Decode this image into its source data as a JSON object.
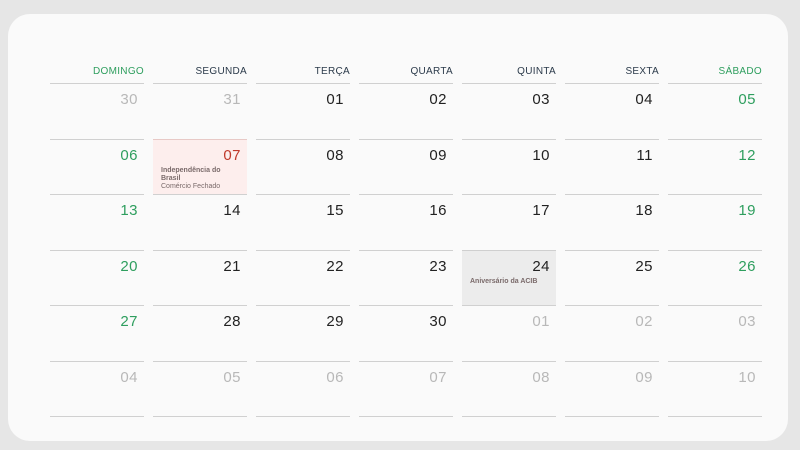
{
  "weekdays": [
    {
      "label": "DOMINGO",
      "weekend": true
    },
    {
      "label": "SEGUNDA",
      "weekend": false
    },
    {
      "label": "TERÇA",
      "weekend": false
    },
    {
      "label": "QUARTA",
      "weekend": false
    },
    {
      "label": "QUINTA",
      "weekend": false
    },
    {
      "label": "SEXTA",
      "weekend": false
    },
    {
      "label": "SÁBADO",
      "weekend": true
    }
  ],
  "weeks": [
    [
      {
        "day": "30",
        "muted": true
      },
      {
        "day": "31",
        "muted": true
      },
      {
        "day": "01"
      },
      {
        "day": "02"
      },
      {
        "day": "03"
      },
      {
        "day": "04"
      },
      {
        "day": "05"
      }
    ],
    [
      {
        "day": "06"
      },
      {
        "day": "07",
        "holiday": true,
        "event_title": "Independência do Brasil",
        "event_note": "Comércio Fechado"
      },
      {
        "day": "08"
      },
      {
        "day": "09"
      },
      {
        "day": "10"
      },
      {
        "day": "11"
      },
      {
        "day": "12"
      }
    ],
    [
      {
        "day": "13"
      },
      {
        "day": "14"
      },
      {
        "day": "15"
      },
      {
        "day": "16"
      },
      {
        "day": "17"
      },
      {
        "day": "18"
      },
      {
        "day": "19"
      }
    ],
    [
      {
        "day": "20"
      },
      {
        "day": "21"
      },
      {
        "day": "22"
      },
      {
        "day": "23"
      },
      {
        "day": "24",
        "event": true,
        "event_title": "Aniversário da ACIB"
      },
      {
        "day": "25"
      },
      {
        "day": "26"
      }
    ],
    [
      {
        "day": "27"
      },
      {
        "day": "28"
      },
      {
        "day": "29"
      },
      {
        "day": "30"
      },
      {
        "day": "01",
        "muted": true
      },
      {
        "day": "02",
        "muted": true
      },
      {
        "day": "03",
        "muted": true
      }
    ],
    [
      {
        "day": "04",
        "muted": true
      },
      {
        "day": "05",
        "muted": true
      },
      {
        "day": "06",
        "muted": true
      },
      {
        "day": "07",
        "muted": true
      },
      {
        "day": "08",
        "muted": true
      },
      {
        "day": "09",
        "muted": true
      },
      {
        "day": "10",
        "muted": true
      }
    ]
  ],
  "colors": {
    "weekend": "#2e9e5e",
    "holiday": "#c0392b",
    "holiday_bg": "#fdeeed",
    "event_bg": "#ececec",
    "muted": "#b8b8b8"
  }
}
